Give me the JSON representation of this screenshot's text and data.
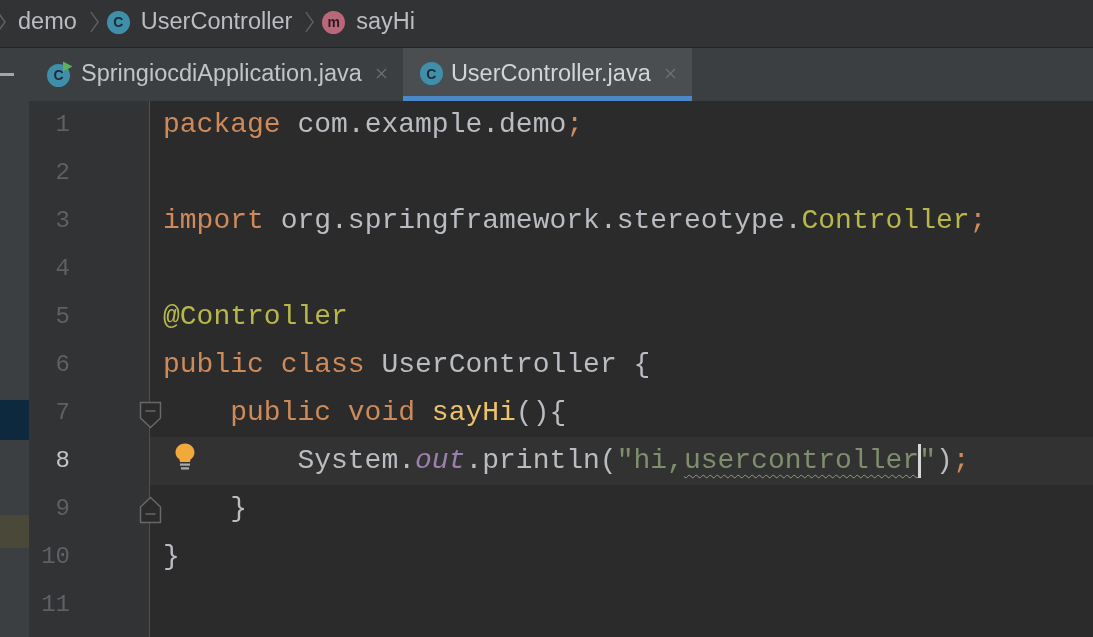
{
  "breadcrumbs": [
    {
      "kind": "folder",
      "label": "demo"
    },
    {
      "kind": "class",
      "icon_letter": "C",
      "label": "UserController"
    },
    {
      "kind": "method",
      "icon_letter": "m",
      "label": "sayHi"
    }
  ],
  "tabs": [
    {
      "kind": "runnable_class",
      "icon_letter": "C",
      "label": "SpringiocdiApplication.java",
      "selected": false
    },
    {
      "kind": "class",
      "icon_letter": "C",
      "label": "UserController.java",
      "selected": true
    }
  ],
  "editor": {
    "lines": [
      {
        "number": "1",
        "current": false,
        "tokens": [
          {
            "kind": "keyword",
            "text": "package"
          },
          {
            "kind": "plain",
            "text": " com.example.demo"
          },
          {
            "kind": "keyword",
            "text": ";"
          }
        ]
      },
      {
        "number": "2",
        "current": false
      },
      {
        "number": "3",
        "current": false,
        "tokens": [
          {
            "kind": "keyword",
            "text": "import"
          },
          {
            "kind": "plain",
            "text": " org.springframework.stereotype."
          },
          {
            "kind": "annotation",
            "text": "Controller"
          },
          {
            "kind": "keyword",
            "text": ";"
          }
        ]
      },
      {
        "number": "4",
        "current": false
      },
      {
        "number": "5",
        "current": false,
        "tokens": [
          {
            "kind": "annotation",
            "text": "@Controller"
          }
        ]
      },
      {
        "number": "6",
        "current": false,
        "tokens": [
          {
            "kind": "keyword",
            "text": "public"
          },
          {
            "kind": "keyword",
            "text": " class"
          },
          {
            "kind": "plain",
            "text": " UserController {"
          }
        ],
        "children": [
          {
            "number": "7",
            "kind": "fold_start",
            "current": false,
            "tokens": [
              {
                "kind": "keyword",
                "text": "public"
              },
              {
                "kind": "keyword",
                "text": " void"
              },
              {
                "kind": "method",
                "text": " sayHi"
              },
              {
                "kind": "plain",
                "text": "(){"
              }
            ],
            "children": [
              {
                "number": "8",
                "kind": "intention",
                "current": true,
                "tokens": [
                  {
                    "kind": "plain",
                    "text": "System."
                  },
                  {
                    "kind": "static_field",
                    "text": "out"
                  },
                  {
                    "kind": "plain",
                    "text": ".println("
                  },
                  {
                    "kind": "string",
                    "text": "\"hi,"
                  },
                  {
                    "kind": "string_typo",
                    "text": "usercontroller"
                  },
                  {
                    "kind": "caret"
                  },
                  {
                    "kind": "string",
                    "text": "\""
                  },
                  {
                    "kind": "plain",
                    "text": ")"
                  },
                  {
                    "kind": "keyword",
                    "text": ";"
                  }
                ]
              }
            ]
          },
          {
            "number": "9",
            "kind": "fold_end",
            "current": false,
            "tokens": [
              {
                "kind": "plain",
                "text": "}"
              }
            ]
          }
        ]
      },
      {
        "number": "10",
        "current": false,
        "tokens": [
          {
            "kind": "plain",
            "text": "}"
          }
        ]
      },
      {
        "number": "11",
        "current": false
      }
    ]
  }
}
